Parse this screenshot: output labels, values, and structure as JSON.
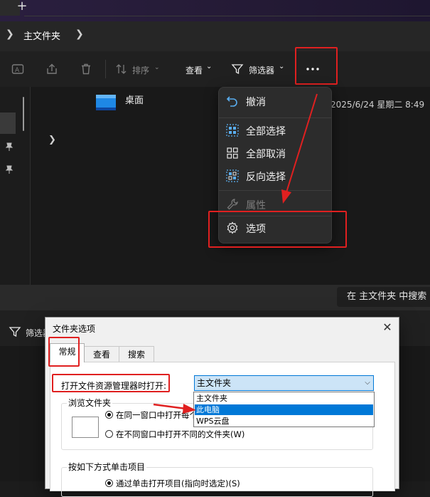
{
  "tabs": {
    "new_tab_icon": "plus-icon"
  },
  "breadcrumb": {
    "current": "主文件夹"
  },
  "toolbar": {
    "sort": "排序",
    "view": "查看",
    "filter": "筛选器",
    "more_icon": "ellipsis-icon"
  },
  "content": {
    "item_name": "桌面",
    "item_date": "2025/6/24 星期二 8:49"
  },
  "context_menu": {
    "items": [
      {
        "label": "撤消",
        "icon": "undo-icon",
        "disabled": false
      },
      {
        "label": "全部选择",
        "icon": "select-all-icon",
        "disabled": false
      },
      {
        "label": "全部取消",
        "icon": "select-none-icon",
        "disabled": false
      },
      {
        "label": "反向选择",
        "icon": "invert-selection-icon",
        "disabled": false
      },
      {
        "label": "属性",
        "icon": "wrench-icon",
        "disabled": true
      },
      {
        "label": "选项",
        "icon": "gear-icon",
        "disabled": false
      }
    ]
  },
  "search": {
    "placeholder": "在 主文件夹 中搜索"
  },
  "lower": {
    "filter_label": "筛选器"
  },
  "dialog": {
    "title": "文件夹选项",
    "tabs": [
      "常规",
      "查看",
      "搜索"
    ],
    "open_label": "打开文件资源管理器时打开:",
    "combo_value": "主文件夹",
    "options": [
      "主文件夹",
      "此电脑",
      "WPS云盘"
    ],
    "selected_option": "此电脑",
    "browse_group": "浏览文件夹",
    "radio_same": "在同一窗口中打开每个文件夹",
    "radio_diff": "在不同窗口中打开不同的文件夹(W)",
    "click_group": "按如下方式单击项目",
    "radio_single": "通过单击打开项目(指向时选定)(S)"
  },
  "colors": {
    "annotation": "#e02020",
    "accent": "#0078d7"
  }
}
